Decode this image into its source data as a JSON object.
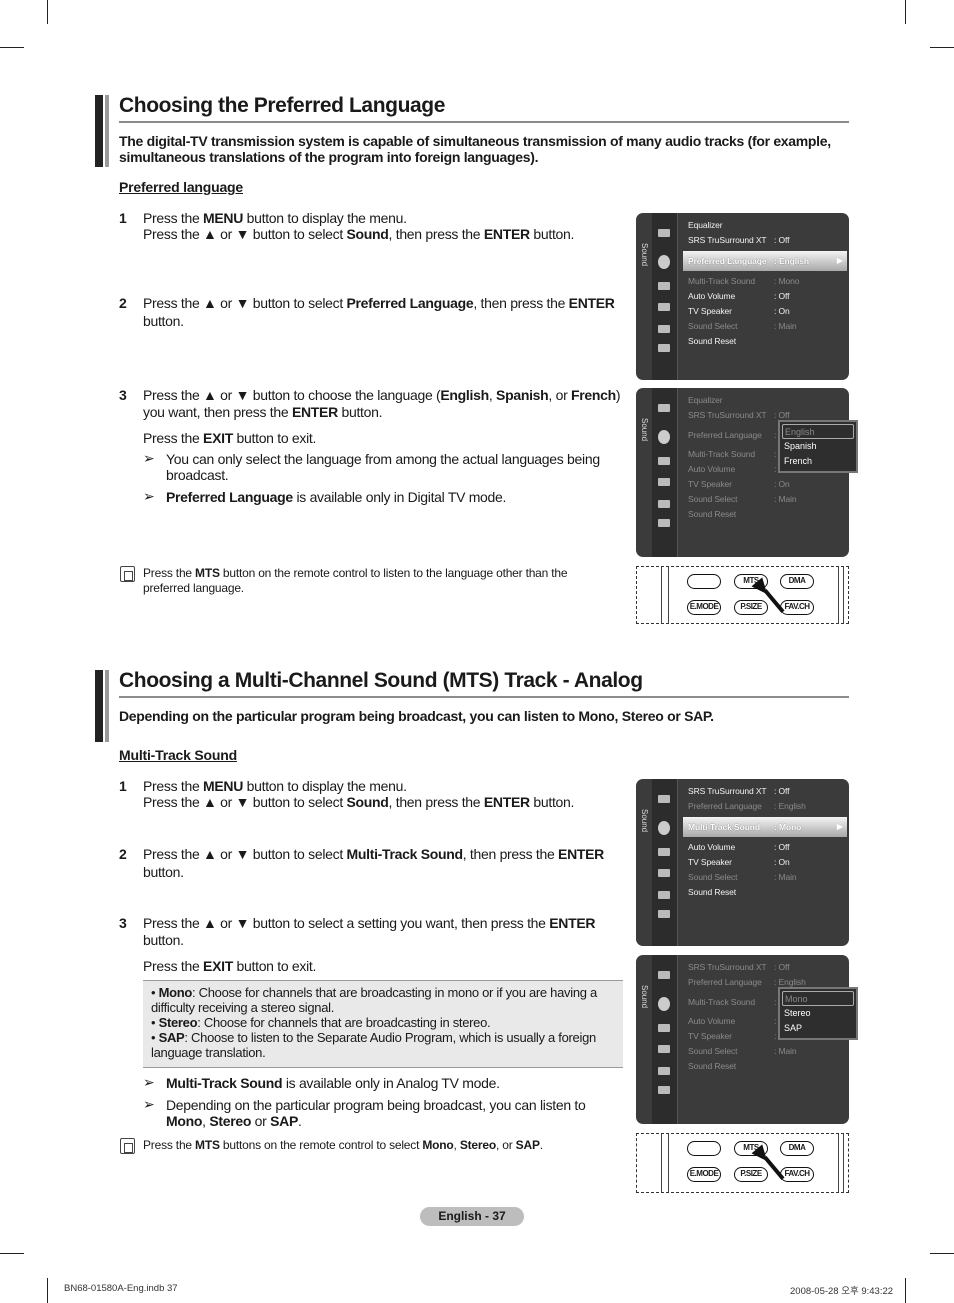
{
  "section1": {
    "title": "Choosing the Preferred Language",
    "intro": "The digital-TV transmission system is capable of simultaneous transmission of many audio tracks (for example, simultaneous translations of the program into foreign languages).",
    "subheading": "Preferred language",
    "steps": [
      {
        "num": "1",
        "lines": [
          [
            {
              "t": "Press the "
            },
            {
              "t": "MENU",
              "b": true
            },
            {
              "t": " button to display the menu."
            }
          ],
          [
            {
              "t": "Press the ▲ or ▼ button to select "
            },
            {
              "t": "Sound",
              "b": true
            },
            {
              "t": ", then press the "
            },
            {
              "t": "ENTER",
              "b": true
            },
            {
              "t": " button."
            }
          ]
        ]
      },
      {
        "num": "2",
        "lines": [
          [
            {
              "t": "Press the ▲ or ▼ button to select "
            },
            {
              "t": "Preferred Language",
              "b": true
            },
            {
              "t": ", then press the "
            },
            {
              "t": "ENTER",
              "b": true
            }
          ],
          [
            {
              "t": "button."
            }
          ]
        ]
      },
      {
        "num": "3",
        "lines": [
          [
            {
              "t": "Press the ▲ or ▼ button to choose the language ("
            },
            {
              "t": "English",
              "b": true
            },
            {
              "t": ", "
            },
            {
              "t": "Spanish",
              "b": true
            },
            {
              "t": ", or "
            },
            {
              "t": "French",
              "b": true
            },
            {
              "t": ")"
            }
          ],
          [
            {
              "t": "you want, then press the "
            },
            {
              "t": "ENTER",
              "b": true
            },
            {
              "t": " button."
            }
          ]
        ]
      }
    ],
    "exit": [
      {
        "t": "Press the "
      },
      {
        "t": "EXIT",
        "b": true
      },
      {
        "t": " button to exit."
      }
    ],
    "tips": [
      {
        "lines": [
          [
            {
              "t": "You can only select the language from among the actual languages being"
            }
          ],
          [
            {
              "t": "broadcast."
            }
          ]
        ]
      },
      {
        "lines": [
          [
            {
              "t": "Preferred Language",
              "b": true
            },
            {
              "t": " is available only in Digital TV mode."
            }
          ]
        ]
      }
    ],
    "note": [
      [
        {
          "t": "Press the "
        },
        {
          "t": "MTS",
          "b": true
        },
        {
          "t": " button on the remote control to listen to the language other than the"
        }
      ],
      [
        {
          "t": "preferred language."
        }
      ]
    ]
  },
  "section2": {
    "title": "Choosing a Multi-Channel Sound (MTS) Track - Analog",
    "intro": "Depending on the particular program being broadcast, you can listen to Mono, Stereo or SAP.",
    "subheading": "Multi-Track Sound",
    "steps": [
      {
        "num": "1",
        "lines": [
          [
            {
              "t": "Press the "
            },
            {
              "t": "MENU",
              "b": true
            },
            {
              "t": " button to display the menu."
            }
          ],
          [
            {
              "t": "Press the ▲ or ▼ button to select "
            },
            {
              "t": "Sound",
              "b": true
            },
            {
              "t": ", then press the "
            },
            {
              "t": "ENTER",
              "b": true
            },
            {
              "t": " button."
            }
          ]
        ]
      },
      {
        "num": "2",
        "lines": [
          [
            {
              "t": "Press the ▲ or ▼ button to select "
            },
            {
              "t": "Multi-Track Sound",
              "b": true
            },
            {
              "t": ", then press the "
            },
            {
              "t": "ENTER",
              "b": true
            }
          ],
          [
            {
              "t": "button."
            }
          ]
        ]
      },
      {
        "num": "3",
        "lines": [
          [
            {
              "t": "Press the ▲ or ▼ button to select a setting you want, then press the "
            },
            {
              "t": "ENTER",
              "b": true
            }
          ],
          [
            {
              "t": "button."
            }
          ]
        ]
      }
    ],
    "exit": [
      {
        "t": "Press the "
      },
      {
        "t": "EXIT",
        "b": true
      },
      {
        "t": " button to exit."
      }
    ],
    "options_box": [
      [
        {
          "t": "• "
        },
        {
          "t": "Mono",
          "b": true
        },
        {
          "t": ": Choose for channels that are broadcasting in mono or if you are having a difficulty receiving a stereo signal."
        }
      ],
      [
        {
          "t": "• "
        },
        {
          "t": "Stereo",
          "b": true
        },
        {
          "t": ": Choose for channels that are broadcasting in stereo."
        }
      ],
      [
        {
          "t": "• "
        },
        {
          "t": "SAP",
          "b": true
        },
        {
          "t": ": Choose to listen to the Separate Audio Program, which is usually a foreign language translation."
        }
      ]
    ],
    "tips": [
      {
        "lines": [
          [
            {
              "t": "Multi-Track Sound",
              "b": true
            },
            {
              "t": " is available only in Analog TV mode."
            }
          ]
        ]
      },
      {
        "lines": [
          [
            {
              "t": "Depending on the particular program being broadcast, you can listen to"
            }
          ],
          [
            {
              "t": "Mono",
              "b": true
            },
            {
              "t": ", "
            },
            {
              "t": "Stereo",
              "b": true
            },
            {
              "t": " or "
            },
            {
              "t": "SAP",
              "b": true
            },
            {
              "t": "."
            }
          ]
        ]
      }
    ],
    "note": [
      [
        {
          "t": "Press the "
        },
        {
          "t": "MTS",
          "b": true
        },
        {
          "t": " buttons on the remote control to select "
        },
        {
          "t": "Mono",
          "b": true
        },
        {
          "t": ", "
        },
        {
          "t": "Stereo",
          "b": true
        },
        {
          "t": ", or "
        },
        {
          "t": "SAP",
          "b": true
        },
        {
          "t": "."
        }
      ]
    ]
  },
  "menus": [
    {
      "side_label": "Sound",
      "highlight": 2,
      "items": [
        {
          "label": "Equalizer",
          "value": ""
        },
        {
          "label": "SRS TruSurround XT",
          "value": ": Off"
        },
        {
          "label": "Preferred Language",
          "value": ": English"
        },
        {
          "label": "Multi-Track Sound",
          "value": ": Mono",
          "dim": true
        },
        {
          "label": "Auto Volume",
          "value": ": Off"
        },
        {
          "label": "TV Speaker",
          "value": ": On"
        },
        {
          "label": "Sound Select",
          "value": ": Main",
          "dim": true
        },
        {
          "label": "Sound Reset",
          "value": ""
        }
      ]
    },
    {
      "side_label": "Sound",
      "popup_at": 2,
      "popup": [
        "English",
        "Spanish",
        "French"
      ],
      "items": [
        {
          "label": "Equalizer",
          "value": "",
          "dim": true
        },
        {
          "label": "SRS TruSurround XT",
          "value": ": Off",
          "dim": true
        },
        {
          "label": "Preferred Language",
          "value": ":",
          "dim": true
        },
        {
          "label": "Multi-Track Sound",
          "value": ":",
          "dim": true
        },
        {
          "label": "Auto Volume",
          "value": ":",
          "dim": true
        },
        {
          "label": "TV Speaker",
          "value": ": On",
          "dim": true
        },
        {
          "label": "Sound Select",
          "value": ": Main",
          "dim": true
        },
        {
          "label": "Sound Reset",
          "value": "",
          "dim": true
        }
      ]
    },
    {
      "side_label": "Sound",
      "highlight": 2,
      "items": [
        {
          "label": "SRS TruSurround XT",
          "value": ": Off"
        },
        {
          "label": "Preferred Language",
          "value": ": English",
          "dim": true
        },
        {
          "label": "Multi-Track Sound",
          "value": ": Mono"
        },
        {
          "label": "Auto Volume",
          "value": ": Off"
        },
        {
          "label": "TV Speaker",
          "value": ": On"
        },
        {
          "label": "Sound Select",
          "value": ": Main",
          "dim": true
        },
        {
          "label": "Sound Reset",
          "value": ""
        }
      ]
    },
    {
      "side_label": "Sound",
      "popup_at": 2,
      "popup": [
        "Mono",
        "Stereo",
        "SAP"
      ],
      "items": [
        {
          "label": "SRS TruSurround XT",
          "value": ": Off",
          "dim": true
        },
        {
          "label": "Preferred Language",
          "value": ": English",
          "dim": true
        },
        {
          "label": "Multi-Track Sound",
          "value": ":",
          "dim": true
        },
        {
          "label": "Auto Volume",
          "value": ":",
          "dim": true
        },
        {
          "label": "TV Speaker",
          "value": ":",
          "dim": true
        },
        {
          "label": "Sound Select",
          "value": ": Main",
          "dim": true
        },
        {
          "label": "Sound Reset",
          "value": "",
          "dim": true
        }
      ]
    }
  ],
  "remote": {
    "buttons": [
      "",
      "MTS",
      "DMA",
      "E.MODE",
      "P.SIZE",
      "FAV.CH"
    ]
  },
  "footer": {
    "page": "English - 37",
    "file": "BN68-01580A-Eng.indb   37",
    "timestamp": "2008-05-28   오후 9:43:22"
  }
}
